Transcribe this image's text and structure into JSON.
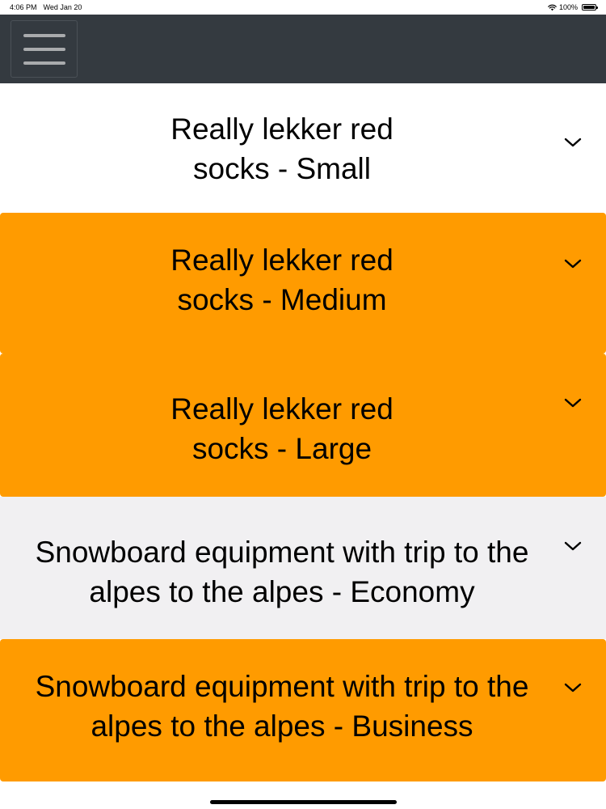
{
  "status_bar": {
    "time": "4:06 PM",
    "date": "Wed Jan 20",
    "battery": "100%",
    "battery_level": 1.0
  },
  "header": {
    "menu_icon": "hamburger-menu-icon",
    "background_color": "#343a40"
  },
  "products": [
    {
      "title": "Really lekker red socks - Small",
      "style": "white",
      "background_color": "#ffffff"
    },
    {
      "title": "Really lekker red socks - Medium",
      "style": "orange",
      "background_color": "#ff9b00"
    },
    {
      "title": "Really lekker red socks - Large",
      "style": "orange",
      "background_color": "#ff9b00"
    },
    {
      "title": "Snowboard equipment with trip to the alpes to the alpes - Economy",
      "style": "grey",
      "background_color": "#f1f0f2"
    },
    {
      "title": "Snowboard equipment with trip to the alpes to the alpes - Business",
      "style": "orange",
      "background_color": "#ff9b00"
    }
  ],
  "icons": {
    "expand": "chevron-down-icon",
    "wifi": "wifi-icon",
    "battery": "battery-icon"
  }
}
